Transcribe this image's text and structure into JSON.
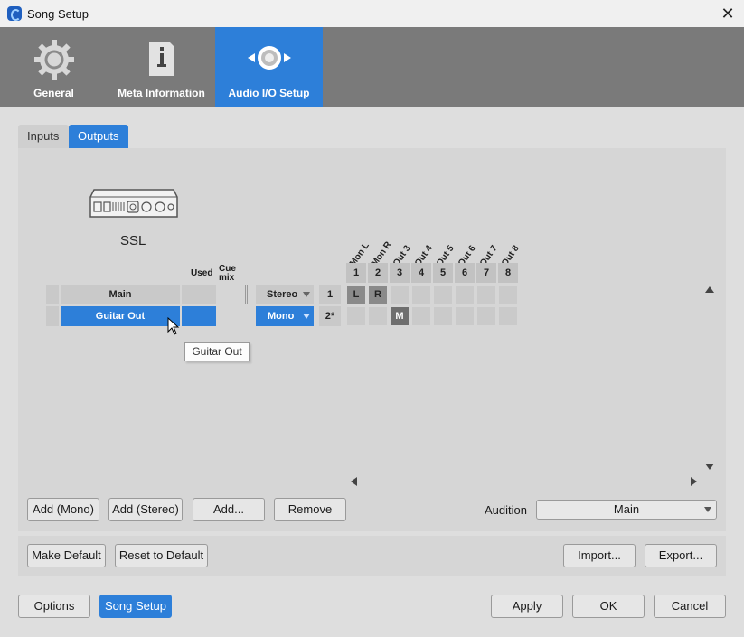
{
  "window": {
    "title": "Song Setup",
    "close": "✕"
  },
  "top_tabs": [
    {
      "label": "General",
      "icon": "gear-icon"
    },
    {
      "label": "Meta Information",
      "icon": "info-icon"
    },
    {
      "label": "Audio I/O Setup",
      "icon": "audio-io-icon",
      "active": true
    }
  ],
  "sub_tabs": {
    "inputs": "Inputs",
    "outputs": "Outputs"
  },
  "device": {
    "name": "SSL"
  },
  "table_headers": {
    "used": "Used",
    "cue_mix": "Cue mix"
  },
  "outputs": [
    {
      "name": "Main",
      "format": "Stereo",
      "channels": "1",
      "selected": false
    },
    {
      "name": "Guitar Out",
      "format": "Mono",
      "channels": "2*",
      "selected": true
    }
  ],
  "hw_outputs": [
    {
      "num": "1",
      "label": "Mon L"
    },
    {
      "num": "2",
      "label": "Mon R"
    },
    {
      "num": "3",
      "label": "Out 3"
    },
    {
      "num": "4",
      "label": "Out 4"
    },
    {
      "num": "5",
      "label": "Out 5"
    },
    {
      "num": "6",
      "label": "Out 6"
    },
    {
      "num": "7",
      "label": "Out 7"
    },
    {
      "num": "8",
      "label": "Out 8"
    }
  ],
  "assignments": {
    "main_l": "L",
    "main_r": "R",
    "guitar_m": "M"
  },
  "tooltip": "Guitar Out",
  "buttons": {
    "add_mono": "Add (Mono)",
    "add_stereo": "Add (Stereo)",
    "add": "Add...",
    "remove": "Remove",
    "make_default": "Make Default",
    "reset_default": "Reset to Default",
    "import": "Import...",
    "export": "Export...",
    "options": "Options",
    "song_setup": "Song Setup",
    "apply": "Apply",
    "ok": "OK",
    "cancel": "Cancel"
  },
  "audition": {
    "label": "Audition",
    "value": "Main"
  },
  "colors": {
    "accent": "#2d7fd9",
    "tab_strip": "#7a7a7a",
    "panel": "#d6d6d6"
  }
}
